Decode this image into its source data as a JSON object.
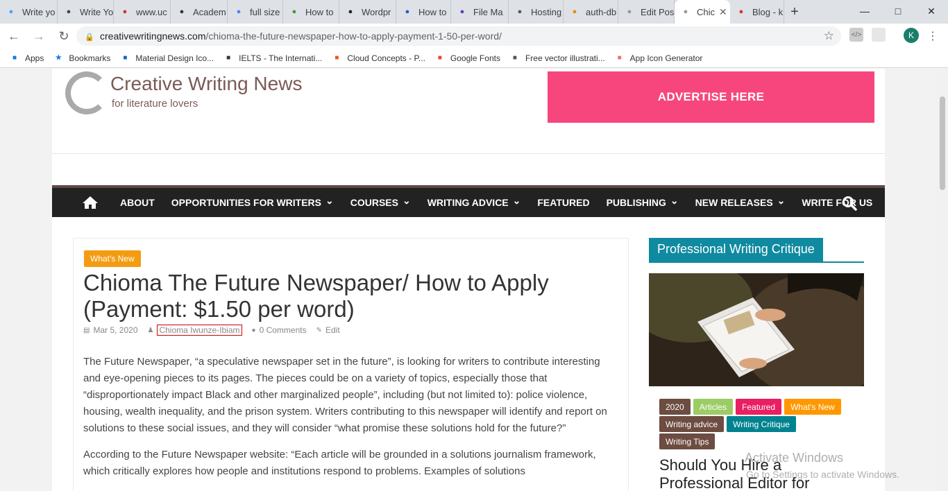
{
  "browser": {
    "tabs": [
      {
        "label": "Write yo",
        "icon": "flutter-icon",
        "color": "#42a5f5"
      },
      {
        "label": "Write Yo",
        "icon": "code-icon",
        "color": "#444"
      },
      {
        "label": "www.uc",
        "icon": "u-icon",
        "color": "#d32f2f"
      },
      {
        "label": "Academ",
        "icon": "a-icon",
        "color": "#333"
      },
      {
        "label": "full size",
        "icon": "google-icon",
        "color": "#4285f4"
      },
      {
        "label": "How to",
        "icon": "fx-icon",
        "color": "#3c9a2e"
      },
      {
        "label": "Wordpr",
        "icon": "h-icon",
        "color": "#222"
      },
      {
        "label": "How to",
        "icon": "m-icon",
        "color": "#1565c0"
      },
      {
        "label": "File Ma",
        "icon": "h-icon",
        "color": "#673ab7"
      },
      {
        "label": "Hosting",
        "icon": "globe-icon",
        "color": "#555"
      },
      {
        "label": "auth-db",
        "icon": "pma-icon",
        "color": "#e68a00"
      },
      {
        "label": "Edit Pos",
        "icon": "loading-icon",
        "color": "#999"
      },
      {
        "label": "Chic",
        "icon": "loading-icon",
        "color": "#999",
        "active": true
      },
      {
        "label": "Blog - k",
        "icon": "gmail-icon",
        "color": "#d93025"
      }
    ],
    "url_domain": "creativewritingnews.com",
    "url_path": "/chioma-the-future-newspaper-how-to-apply-payment-1-50-per-word/",
    "profile_initial": "K",
    "bookmarks": [
      {
        "label": "Apps",
        "icon": "apps-grid-icon",
        "color": "#1a73e8"
      },
      {
        "label": "Bookmarks",
        "icon": "star-icon",
        "color": "#1a73e8"
      },
      {
        "label": "Material Design Ico...",
        "icon": "material-icon",
        "color": "#1565c0"
      },
      {
        "label": "IELTS - The Internati...",
        "icon": "ielts-icon",
        "color": "#333"
      },
      {
        "label": "Cloud Concepts - P...",
        "icon": "microsoft-icon",
        "color": "#f25022"
      },
      {
        "label": "Google Fonts",
        "icon": "fonts-icon",
        "color": "#ea4335"
      },
      {
        "label": "Free vector illustrati...",
        "icon": "vector-icon",
        "color": "#555"
      },
      {
        "label": "App Icon Generator",
        "icon": "grid-icon",
        "color": "#e57373"
      }
    ]
  },
  "site": {
    "name": "Creative Writing News",
    "tagline": "for literature lovers",
    "advertise": "ADVERTISE HERE",
    "nav": [
      {
        "label": "ABOUT",
        "dropdown": false
      },
      {
        "label": "OPPORTUNITIES FOR WRITERS",
        "dropdown": true
      },
      {
        "label": "COURSES",
        "dropdown": true
      },
      {
        "label": "WRITING ADVICE",
        "dropdown": true
      },
      {
        "label": "FEATURED",
        "dropdown": false
      },
      {
        "label": "PUBLISHING",
        "dropdown": true
      },
      {
        "label": "NEW RELEASES",
        "dropdown": true
      },
      {
        "label": "WRITE FOR US",
        "dropdown": false
      }
    ]
  },
  "article": {
    "category": "What's New",
    "title": "Chioma The Future Newspaper/ How to Apply (Payment: $1.50 per word)",
    "date": "Mar 5, 2020",
    "author": "Chioma Iwunze-Ibiam",
    "comments": "0 Comments",
    "edit": "Edit",
    "paragraphs": [
      "The Future Newspaper, “a speculative newspaper set in the future”, is looking for writers to contribute interesting and eye-opening pieces to its pages. The pieces could be on a variety of topics, especially those that “disproportionately impact Black and other marginalized people”, including (but not limited to): police violence, housing, wealth inequality, and the prison system. Writers contributing to this newspaper will identify and report on solutions to these social issues, and they will consider “what promise these solutions hold for the future?”",
      "According to the Future Newspaper website: “Each article will be grounded in a solutions journalism framework, which critically explores how people and institutions respond to problems. Examples of solutions"
    ]
  },
  "sidebar": {
    "widget_title": "Professional Writing Critique",
    "tags": [
      {
        "label": "2020",
        "color": "#6d4c41"
      },
      {
        "label": "Articles",
        "color": "#9ccc65"
      },
      {
        "label": "Featured",
        "color": "#e91e63"
      },
      {
        "label": "What's New",
        "color": "#ff9800"
      },
      {
        "label": "Writing advice",
        "color": "#6d4c41"
      },
      {
        "label": "Writing Critique",
        "color": "#00838f"
      },
      {
        "label": "Writing Tips",
        "color": "#6d4c41"
      }
    ],
    "post_title": "Should You Hire a Professional Editor for"
  },
  "os": {
    "watermark_title": "Activate Windows",
    "watermark_sub": "Go to Settings to activate Windows."
  }
}
